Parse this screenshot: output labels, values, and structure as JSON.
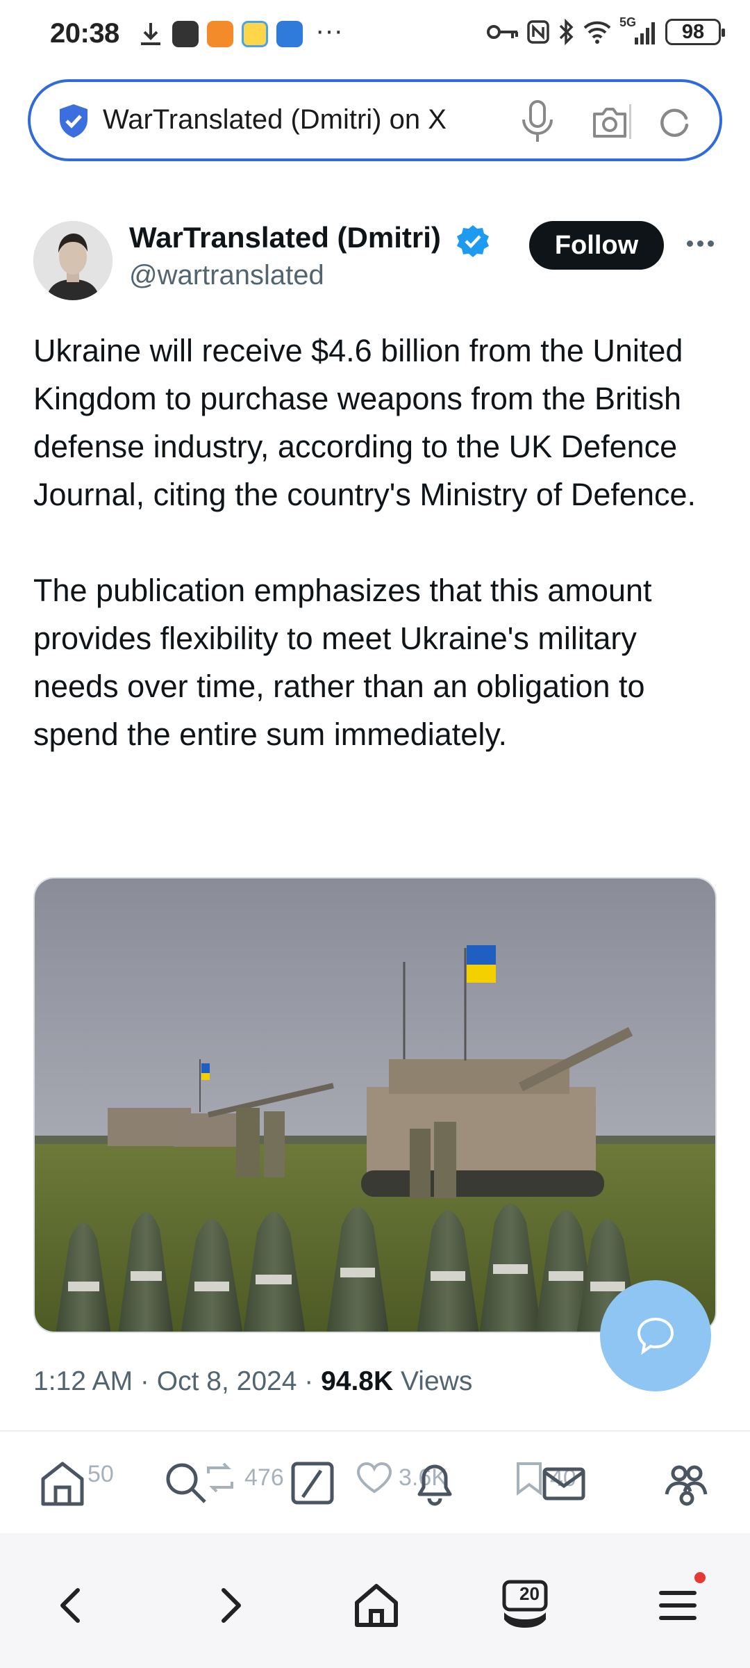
{
  "status_bar": {
    "time": "20:38",
    "overflow": "···",
    "battery": "98",
    "network": "5G",
    "icons_left": [
      "download-icon",
      "app-icon-1",
      "app-icon-2",
      "app-icon-3",
      "app-icon-4"
    ],
    "icons_right": [
      "key-icon",
      "nfc-icon",
      "bluetooth-icon",
      "wifi-icon",
      "signal-icon",
      "battery-icon"
    ]
  },
  "address_bar": {
    "url_text": "WarTranslated (Dmitri) on X",
    "accent": "#2f6bdf"
  },
  "tweet": {
    "author_name": "WarTranslated (Dmitri)",
    "handle": "@wartranslated",
    "follow_label": "Follow",
    "paragraphs": [
      "Ukraine will receive $4.6 billion from the United Kingdom to purchase weapons from the British defense industry, according to the UK Defence Journal, citing the country's Ministry of Defence.",
      "The publication emphasizes that this amount provides flexibility to meet Ukraine's military needs over time, rather than an obligation to spend the entire sum immediately."
    ],
    "time": "1:12 AM",
    "date": "Oct 8, 2024",
    "views_count": "94.8K",
    "views_label": "Views",
    "verified_color": "#1d9bf0"
  },
  "actions": {
    "replies": "50",
    "reposts": "476",
    "likes": "3.6K",
    "bookmarks": "40"
  },
  "x_nav": [
    "home-icon",
    "search-icon",
    "grok-icon",
    "notifications-icon",
    "messages-icon",
    "communities-icon"
  ],
  "browser_nav": {
    "tab_count": "20",
    "buttons": [
      "back-icon",
      "forward-icon",
      "home-icon",
      "tabs-icon",
      "menu-icon"
    ]
  }
}
